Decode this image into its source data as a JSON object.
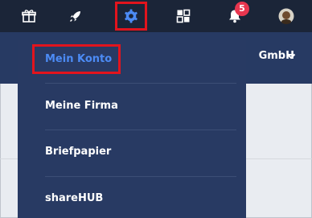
{
  "topbar": {
    "icons": [
      "gift-icon",
      "rocket-icon",
      "gear-icon",
      "apps-icon",
      "bell-icon",
      "avatar"
    ],
    "notifications_count": "5"
  },
  "header": {
    "organization": "GmbH"
  },
  "menu": {
    "items": [
      {
        "label": "Mein Konto",
        "active": true
      },
      {
        "label": "Meine Firma"
      },
      {
        "label": "Briefpapier"
      },
      {
        "label": "shareHUB"
      }
    ]
  },
  "colors": {
    "topbar_bg": "#1b2538",
    "menu_bg": "#283a63",
    "accent": "#4c8bf5",
    "highlight_border": "#e2141d",
    "badge": "#e8364f"
  }
}
